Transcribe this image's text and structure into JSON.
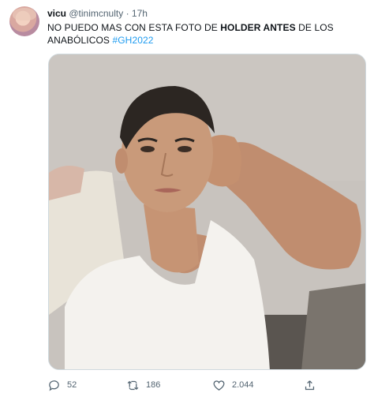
{
  "tweet": {
    "name": "vicu",
    "handle": "@tinimcnulty",
    "separator": "·",
    "time": "17h",
    "text_part1": "NO PUEDO MAS CON ESTA FOTO DE ",
    "text_bold": "HOLDER ANTES",
    "text_part2": " DE LOS ANABÓLICOS ",
    "hashtag": "#GH2022"
  },
  "actions": {
    "replies": "52",
    "retweets": "186",
    "likes": "2.044"
  },
  "icons": [
    "reply-icon",
    "retweet-icon",
    "like-icon",
    "share-icon"
  ],
  "colors": {
    "link": "#1d9bf0",
    "muted": "#536471"
  }
}
